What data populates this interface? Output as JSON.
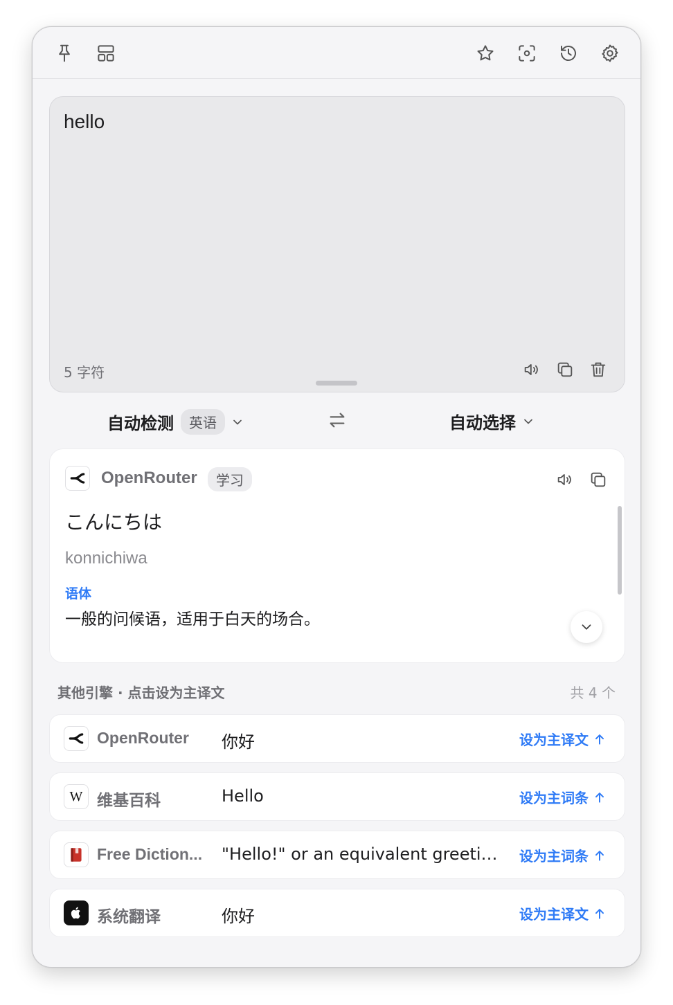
{
  "toolbar": {
    "left_icons": [
      "pin-icon",
      "layout-icon"
    ],
    "right_icons": [
      "star-icon",
      "screenshot-ocr-icon",
      "history-icon",
      "gear-icon"
    ]
  },
  "input": {
    "text": "hello",
    "char_count": "5 字符"
  },
  "languages": {
    "source_label": "自动检测",
    "detected_badge": "英语",
    "target_label": "自动选择"
  },
  "result": {
    "engine": "OpenRouter",
    "tag": "学习",
    "translation": "こんにちは",
    "romanization": "konnichiwa",
    "section_label": "语体",
    "note": "一般的问候语，适用于白天的场合。"
  },
  "others": {
    "header": "其他引擎 · 点击设为主译文",
    "count": "共 4 个",
    "items": [
      {
        "engine": "OpenRouter",
        "text": "你好",
        "action": "设为主译文",
        "icon": "openrouter-logo-icon"
      },
      {
        "engine": "维基百科",
        "text": "Hello",
        "action": "设为主词条",
        "icon": "wikipedia-logo-icon"
      },
      {
        "engine": "Free Diction...",
        "text": "\"Hello!\" or an equivalent greetin...",
        "action": "设为主词条",
        "icon": "dictionary-book-icon"
      },
      {
        "engine": "系统翻译",
        "text": "你好",
        "action": "设为主译文",
        "icon": "apple-logo-icon"
      }
    ]
  },
  "colors": {
    "accent": "#2f7bf6",
    "background": "#f5f5f7",
    "input_bg": "#e9e9eb"
  }
}
